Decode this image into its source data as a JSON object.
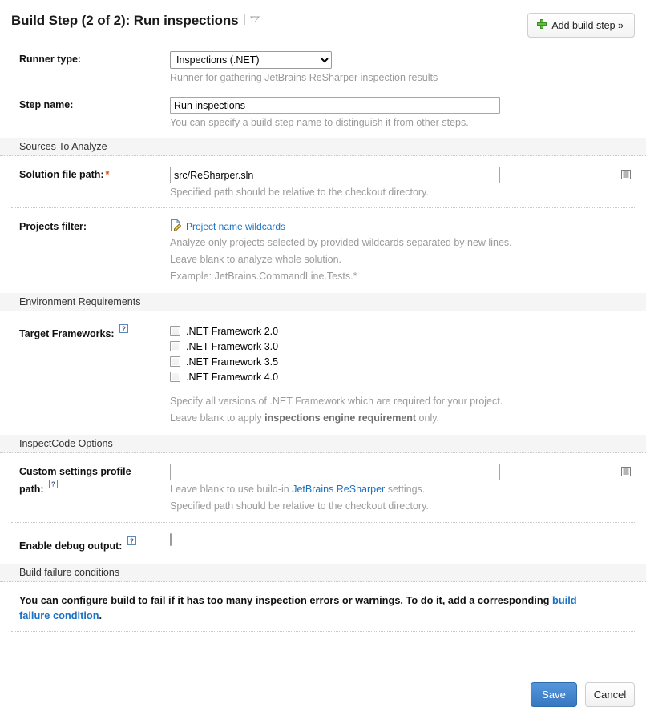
{
  "header": {
    "title": "Build Step (2 of 2): Run inspections",
    "title_caret_icon": "chevron-down-icon",
    "add_build_step_label": "Add build step »",
    "add_build_step_icon": "plus-icon"
  },
  "runner": {
    "label": "Runner type:",
    "selected": "Inspections (.NET)",
    "options": [
      "Inspections (.NET)"
    ],
    "hint": "Runner for gathering JetBrains ReSharper inspection results"
  },
  "step_name": {
    "label": "Step name:",
    "value": "Run inspections",
    "placeholder": "",
    "hint": "You can specify a build step name to distinguish it from other steps."
  },
  "sources_section": {
    "title": "Sources To Analyze",
    "solution_path": {
      "label": "Solution file path:",
      "required_marker": "*",
      "value": "src/ReSharper.sln",
      "placeholder": "",
      "picker_icon": "file-picker-icon",
      "hint": "Specified path should be relative to the checkout directory."
    },
    "projects_filter": {
      "label": "Projects filter:",
      "link_label": "Project name wildcards",
      "link_icon": "edit-document-icon",
      "hint_line1": "Analyze only projects selected by provided wildcards separated by new lines.",
      "hint_line2": "Leave blank to analyze whole solution.",
      "hint_line3": "Example: JetBrains.CommandLine.Tests.*"
    }
  },
  "environment_section": {
    "title": "Environment Requirements",
    "target_frameworks": {
      "label": "Target Frameworks:",
      "help_icon": "help-icon",
      "options": [
        {
          "label": ".NET Framework 2.0",
          "checked": false
        },
        {
          "label": ".NET Framework 3.0",
          "checked": false
        },
        {
          "label": ".NET Framework 3.5",
          "checked": false
        },
        {
          "label": ".NET Framework 4.0",
          "checked": false
        }
      ],
      "hint_line1": "Specify all versions of .NET Framework which are required for your project.",
      "hint_line2_pre": "Leave blank to apply ",
      "hint_line2_bold": "inspections engine requirement",
      "hint_line2_post": " only."
    }
  },
  "inspectcode_section": {
    "title": "InspectCode Options",
    "custom_settings": {
      "label_line1": "Custom settings profile",
      "label_line2": "path:",
      "help_icon": "help-icon",
      "value": "",
      "placeholder": "",
      "picker_icon": "file-picker-icon",
      "hint_line1_pre": "Leave blank to use build-in ",
      "hint_line1_link": "JetBrains ReSharper",
      "hint_line1_post": " settings.",
      "hint_line2": "Specified path should be relative to the checkout directory."
    },
    "enable_debug": {
      "label": "Enable debug output:",
      "help_icon": "help-icon",
      "checked": false
    }
  },
  "failure_section": {
    "title": "Build failure conditions",
    "text_pre": "You can configure build to fail if it has too many inspection errors or warnings. To do it, add a corresponding ",
    "link_label": "build failure condition",
    "text_post": "."
  },
  "footer": {
    "save_label": "Save",
    "cancel_label": "Cancel"
  },
  "colors": {
    "link": "#1a72c4",
    "required": "#d9450a",
    "save_button": "#3677c0",
    "plus_icon": "#4caa28",
    "section_header_bg": "#f5f5f5"
  }
}
